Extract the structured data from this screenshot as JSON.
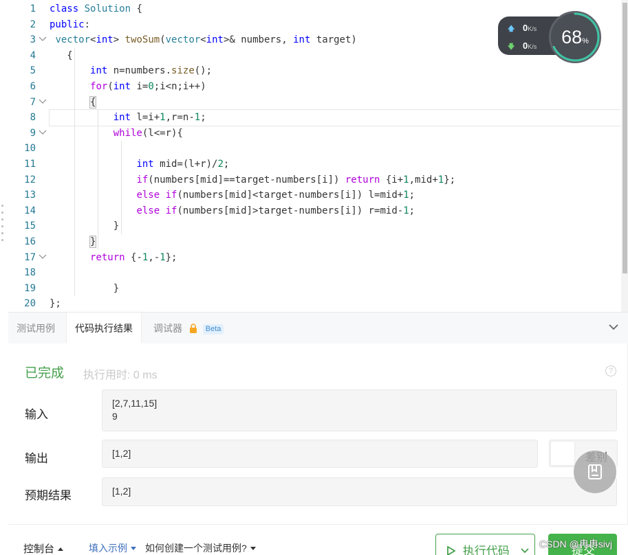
{
  "editor": {
    "lines": [
      {
        "n": "1",
        "code": "<span class='kw'>class</span> <span class='ty'>Solution</span> {"
      },
      {
        "n": "2",
        "code": "<span class='kw'>public</span>:"
      },
      {
        "n": "3",
        "code": " <span class='ty'>vector</span>&lt;<span class='kw'>int</span>&gt; <span class='fn'>twoSum</span>(<span class='ty'>vector</span>&lt;<span class='kw'>int</span>&gt;&amp; <span class='pn'>numbers</span>, <span class='kw'>int</span> <span class='pn'>target</span>)"
      },
      {
        "n": "4",
        "code": "   {"
      },
      {
        "n": "5",
        "code": "       <span class='kw'>int</span> n=numbers.<span class='fn'>size</span>();"
      },
      {
        "n": "6",
        "code": "       <span class='kw2'>for</span>(<span class='kw'>int</span> i=<span class='num'>0</span>;i&lt;n;i++)"
      },
      {
        "n": "7",
        "code": "       <span class='bracket-hl'>{</span>"
      },
      {
        "n": "8",
        "code": "           <span class='kw'>int</span> l=i+<span class='num'>1</span>,r=n-<span class='num'>1</span>;"
      },
      {
        "n": "9",
        "code": "           <span class='kw2'>while</span>(l&lt;=r){"
      },
      {
        "n": "10",
        "code": ""
      },
      {
        "n": "11",
        "code": "               <span class='kw'>int</span> mid=(l+r)/<span class='num'>2</span>;"
      },
      {
        "n": "12",
        "code": "               <span class='kw2'>if</span>(numbers[mid]==target-numbers[i]) <span class='kw2'>return</span> {i+<span class='num'>1</span>,mid+<span class='num'>1</span>};"
      },
      {
        "n": "13",
        "code": "               <span class='kw2'>else</span> <span class='kw2'>if</span>(numbers[mid]&lt;target-numbers[i]) l=mid+<span class='num'>1</span>;"
      },
      {
        "n": "14",
        "code": "               <span class='kw2'>else</span> <span class='kw2'>if</span>(numbers[mid]&gt;target-numbers[i]) r=mid-<span class='num'>1</span>;"
      },
      {
        "n": "15",
        "code": "           }"
      },
      {
        "n": "16",
        "code": "       <span class='bracket-hl'>}</span>"
      },
      {
        "n": "17",
        "code": "       <span class='kw2'>return</span> {-<span class='num'>1</span>,-<span class='num'>1</span>};"
      },
      {
        "n": "18",
        "code": ""
      },
      {
        "n": "19",
        "code": "           }"
      },
      {
        "n": "20",
        "code": "};"
      }
    ],
    "fold_lines": [
      "3",
      "7",
      "9",
      "17"
    ],
    "current_line": "8"
  },
  "net_widget": {
    "up_speed": "0",
    "down_speed": "0",
    "unit": "K/s",
    "cpu_percent": "68",
    "cpu_level": 0.68,
    "percent_sign": "%"
  },
  "tabs": {
    "test_cases": "测试用例",
    "run_result": "代码执行结果",
    "debugger": "调试器",
    "beta": "Beta"
  },
  "result": {
    "status": "已完成",
    "runtime": "执行用时: 0 ms",
    "help": "?",
    "input_label": "输入",
    "input_value_1": "[2,7,11,15]",
    "input_value_2": "9",
    "output_label": "输出",
    "output_value": "[1,2]",
    "diff_label": "差别",
    "expected_label": "预期结果",
    "expected_value": "[1,2]"
  },
  "footer": {
    "console": "控制台",
    "fill_example": "填入示例",
    "how_to": "如何创建一个测试用例?",
    "run_code": "执行代码",
    "submit": "提交",
    "watermark": "CSDN @冉冉sivj"
  },
  "colors": {
    "accent_green": "#45a04b",
    "link_blue": "#3e6fbe"
  }
}
